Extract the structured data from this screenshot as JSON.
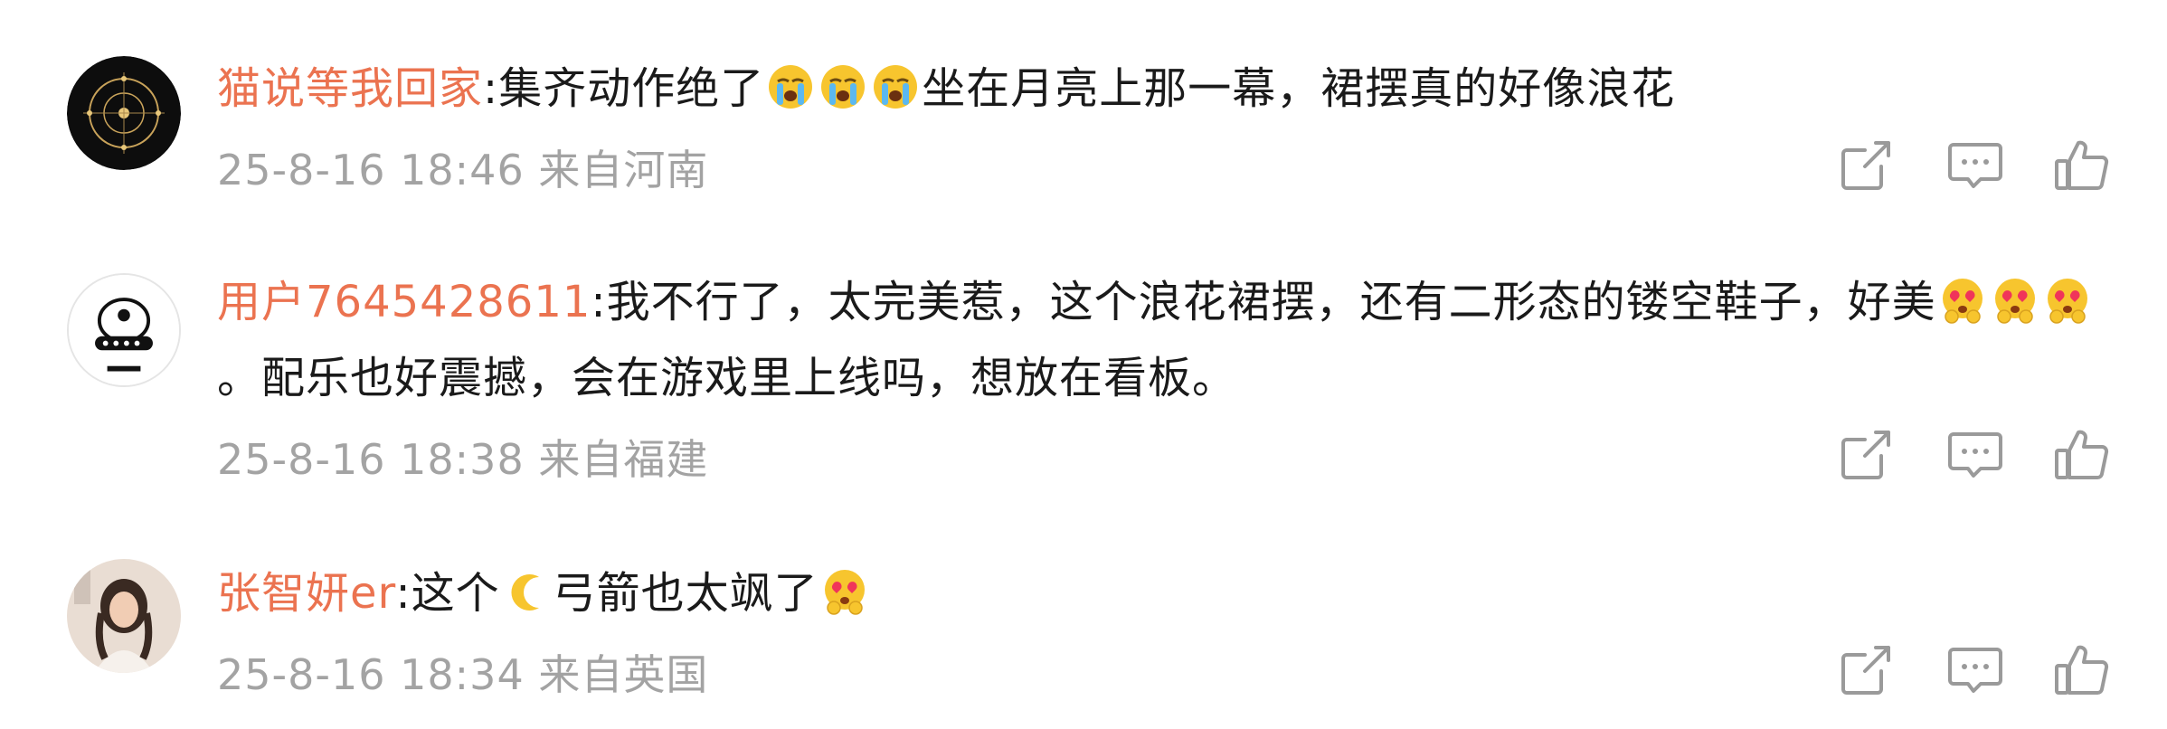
{
  "comments": [
    {
      "username": "猫说等我回家",
      "separator": ":",
      "text_a": "集齐动作绝了",
      "emojis_a": [
        "loudly-crying-face",
        "loudly-crying-face",
        "loudly-crying-face"
      ],
      "text_b": "坐在月亮上那一幕，裙摆真的好像浪花",
      "time": "25-8-16 18:46",
      "location": "来自河南"
    },
    {
      "username": "用户7645428611",
      "separator": ":",
      "text_a": "我不行了，太完美惹，这个浪花裙摆，还有二形态的镂空鞋子，好美",
      "emojis_a": [
        "heart-eyes-pleading-face",
        "heart-eyes-pleading-face",
        "heart-eyes-pleading-face"
      ],
      "text_b": "。配乐也好震撼，会在游戏里上线吗，想放在看板。",
      "time": "25-8-16 18:38",
      "location": "来自福建"
    },
    {
      "username": "张智妍er",
      "separator": ":",
      "text_a": "这个",
      "emoji_mid": "crescent-moon",
      "text_b": "弓箭也太飒了",
      "emojis_b": [
        "heart-eyes-pleading-face"
      ],
      "time": "25-8-16 18:34",
      "location": "来自英国"
    }
  ],
  "actions": [
    "share-icon",
    "comment-icon",
    "like-icon"
  ],
  "colors": {
    "username": "#eb7350",
    "meta": "#a3a3a3",
    "text": "#1a1a1a",
    "icon": "#9a9a9a"
  }
}
